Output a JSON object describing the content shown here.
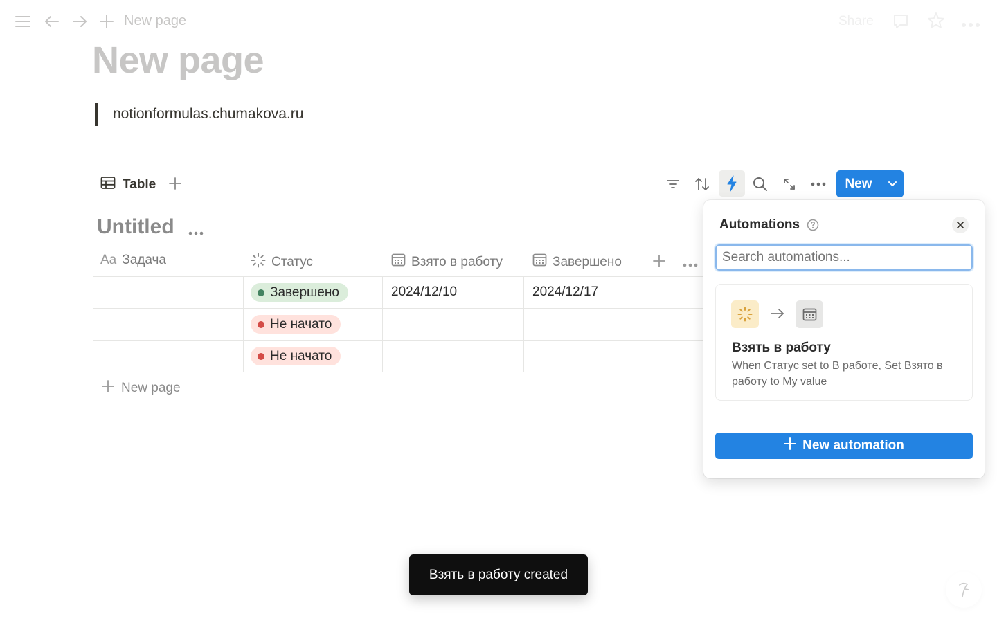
{
  "topbar": {
    "breadcrumb": "New page",
    "share_label": "Share"
  },
  "page": {
    "title": "New page",
    "quote": "notionformulas.chumakova.ru"
  },
  "database": {
    "view_label": "Table",
    "title": "Untitled",
    "new_button_label": "New",
    "columns": [
      {
        "prefix": "Aa",
        "label": "Задача",
        "icon": "text-icon"
      },
      {
        "label": "Статус",
        "icon": "status-icon"
      },
      {
        "label": "Взято в работу",
        "icon": "calendar-icon"
      },
      {
        "label": "Завершено",
        "icon": "calendar-icon"
      }
    ],
    "rows": [
      {
        "task": "",
        "status": "Завершено",
        "status_color": "#448361",
        "status_bg": "#dbeddb",
        "taken": "2024/12/10",
        "done": "2024/12/17"
      },
      {
        "task": "",
        "status": "Не начато",
        "status_color": "#d44c47",
        "status_bg": "#ffe2dd",
        "taken": "",
        "done": ""
      },
      {
        "task": "",
        "status": "Не начато",
        "status_color": "#d44c47",
        "status_bg": "#ffe2dd",
        "taken": "",
        "done": ""
      }
    ],
    "new_row_label": "New page"
  },
  "automations": {
    "title": "Automations",
    "search_placeholder": "Search automations...",
    "items": [
      {
        "name": "Взять в работу",
        "description": "When Статус set to В работе, Set Взято в работу to My value"
      }
    ],
    "new_automation_label": "New automation"
  },
  "toast": {
    "message": "Взять в работу created"
  },
  "colors": {
    "accent": "#2383e2",
    "text": "#37352f",
    "muted": "#7a7a7a"
  }
}
